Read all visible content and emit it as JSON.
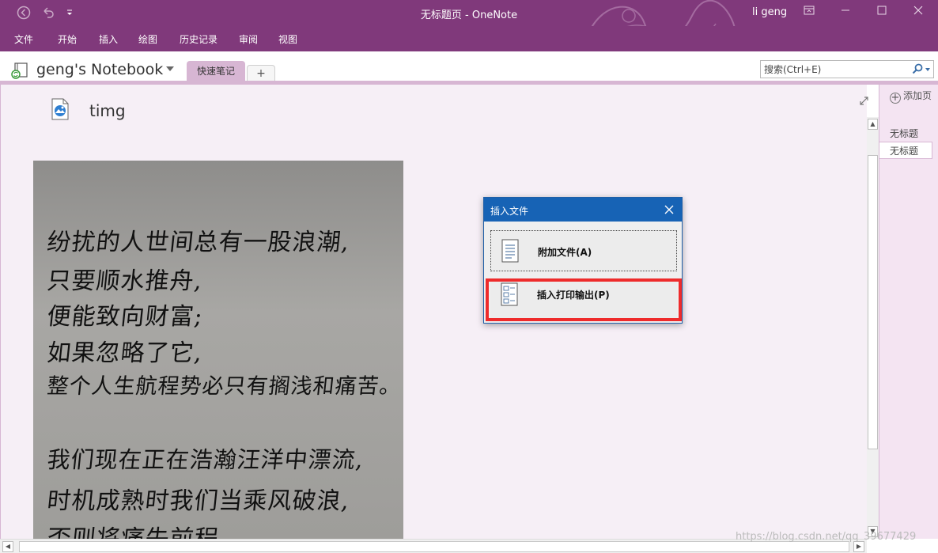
{
  "window": {
    "title": "无标题页 - OneNote",
    "user": "li geng",
    "controls": [
      "restore-icon",
      "minimize-icon",
      "maximize-icon",
      "close-icon"
    ]
  },
  "menu": {
    "items": [
      "文件",
      "开始",
      "插入",
      "绘图",
      "历史记录",
      "审阅",
      "视图"
    ]
  },
  "notebook": {
    "name": "geng's Notebook",
    "tabs": [
      "快速笔记"
    ],
    "add_tab": "+"
  },
  "search": {
    "placeholder": "搜索(Ctrl+E)"
  },
  "page": {
    "file_name": "timg",
    "handwriting": [
      "纷扰的人世间总有一股浪潮,",
      "只要顺水推舟,",
      "便能致向财富;",
      "如果忽略了它,",
      "整个人生航程势必只有搁浅和痛苦。",
      "我们现在正在浩瀚汪洋中漂流,",
      "时机成熟时我们当乘风破浪,",
      "否则将痛失前程"
    ]
  },
  "pages_pane": {
    "add_page": "添加页",
    "items": [
      "无标题",
      "无标题"
    ]
  },
  "dialog": {
    "title": "插入文件",
    "options": [
      "附加文件(A)",
      "插入打印输出(P)"
    ]
  },
  "watermark": "https://blog.csdn.net/qq_39677429",
  "colors": {
    "onenote_purple": "#80397b",
    "tab_purple": "#d7b6d3",
    "dialog_blue": "#1763b5",
    "highlight_red": "#ee2b2b"
  }
}
